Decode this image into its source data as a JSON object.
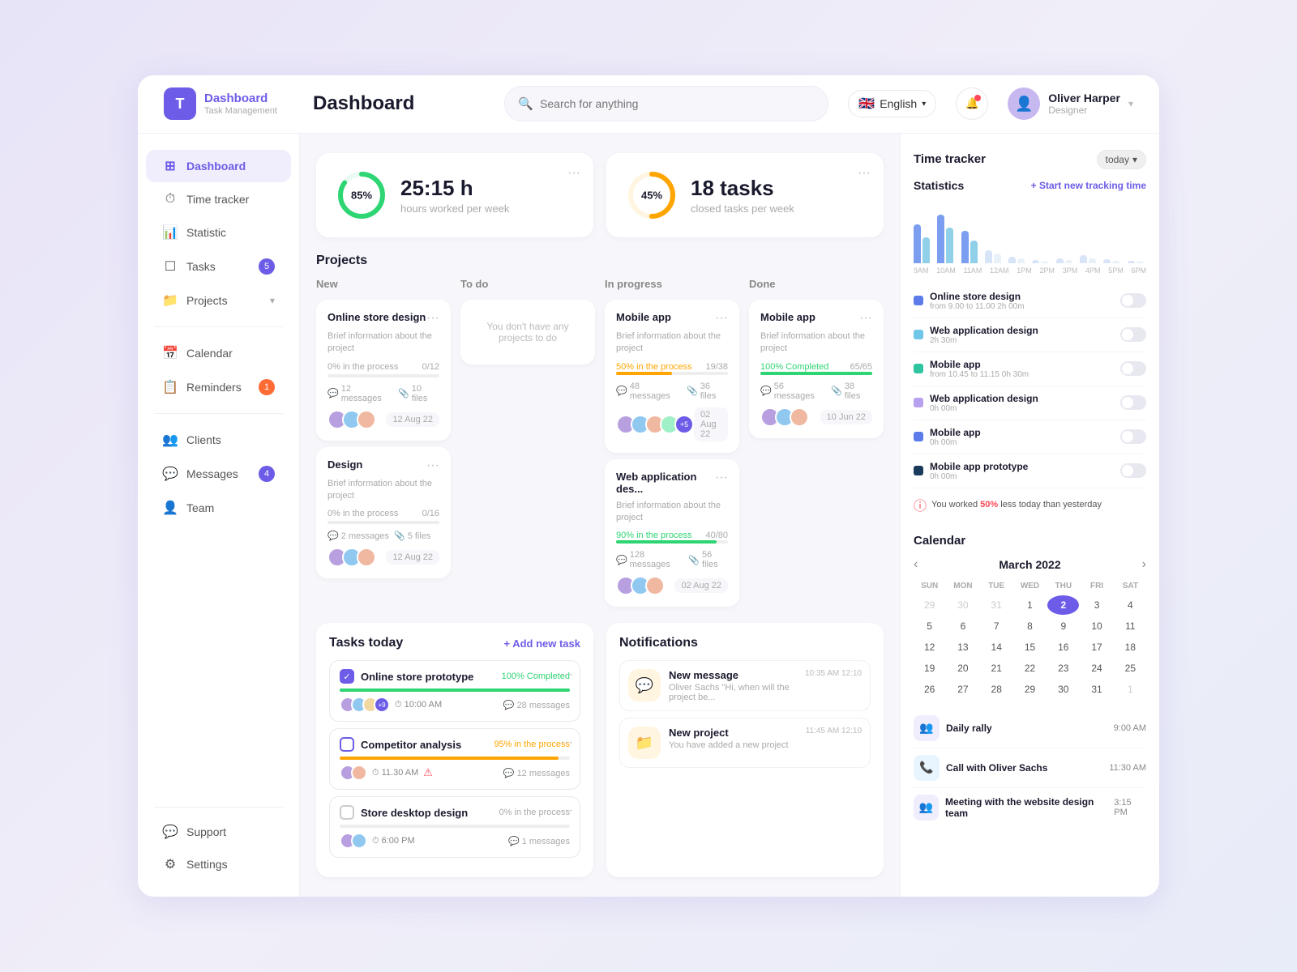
{
  "app": {
    "logo_letter": "T",
    "logo_title": "Dashboard",
    "logo_sub": "Task Management",
    "page_title": "Dashboard"
  },
  "header": {
    "search_placeholder": "Search for anything",
    "language": "English",
    "user_name": "Oliver Harper",
    "user_role": "Designer"
  },
  "sidebar": {
    "items": [
      {
        "id": "dashboard",
        "label": "Dashboard",
        "icon": "⊞",
        "active": true
      },
      {
        "id": "time-tracker",
        "label": "Time tracker",
        "icon": "○"
      },
      {
        "id": "statistic",
        "label": "Statistic",
        "icon": "📊"
      },
      {
        "id": "tasks",
        "label": "Tasks",
        "icon": "☐",
        "badge": "5"
      },
      {
        "id": "projects",
        "label": "Projects",
        "icon": "📁",
        "chevron": true
      }
    ],
    "items2": [
      {
        "id": "calendar",
        "label": "Calendar",
        "icon": "📅"
      },
      {
        "id": "reminders",
        "label": "Reminders",
        "icon": "📋",
        "badge": "1",
        "badge_color": "orange"
      }
    ],
    "items3": [
      {
        "id": "clients",
        "label": "Clients",
        "icon": "👥"
      },
      {
        "id": "messages",
        "label": "Messages",
        "icon": "💬",
        "badge": "4"
      },
      {
        "id": "team",
        "label": "Team",
        "icon": "👤"
      }
    ],
    "bottom": [
      {
        "id": "support",
        "label": "Support",
        "icon": "💬"
      },
      {
        "id": "settings",
        "label": "Settings",
        "icon": "⚙"
      }
    ]
  },
  "stats": [
    {
      "pct": 85,
      "value": "25:15 h",
      "label": "hours worked per week",
      "color_stroke": "#2ed573",
      "color_track": "#e8faf2"
    },
    {
      "pct": 45,
      "value": "18 tasks",
      "label": "closed tasks per week",
      "color_stroke": "#ffa502",
      "color_track": "#fff5e0"
    }
  ],
  "projects": {
    "section_title": "Projects",
    "columns": [
      {
        "id": "new",
        "label": "New"
      },
      {
        "id": "todo",
        "label": "To do"
      },
      {
        "id": "inprogress",
        "label": "In progress"
      },
      {
        "id": "done",
        "label": "Done"
      }
    ],
    "cards": {
      "new": [
        {
          "title": "Online store design",
          "desc": "Brief information about the project",
          "progress_label": "0% in the process",
          "progress_pct": 0,
          "progress_count": "0/12",
          "progress_color": "gray",
          "messages": "12 messages",
          "files": "10 files",
          "date": "12 Aug 22",
          "avatars": [
            "#b8a0e0",
            "#90c8f0",
            "#f0b8a0"
          ]
        },
        {
          "title": "Design",
          "desc": "Brief information about the project",
          "progress_label": "0% in the process",
          "progress_pct": 0,
          "progress_count": "0/16",
          "progress_color": "gray",
          "messages": "2 messages",
          "files": "5 files",
          "date": "12 Aug 22",
          "avatars": [
            "#b8a0e0",
            "#90c8f0",
            "#f0b8a0"
          ]
        }
      ],
      "todo": [],
      "inprogress": [
        {
          "title": "Mobile app",
          "desc": "Brief information about the project",
          "progress_label": "50% in the process",
          "progress_pct": 50,
          "progress_count": "19/38",
          "progress_color": "orange",
          "messages": "48 messages",
          "files": "36 files",
          "date": "02 Aug 22",
          "avatars": [
            "#b8a0e0",
            "#90c8f0",
            "#f0b8a0",
            "#a0f0c8",
            "#f0d8a0"
          ]
        },
        {
          "title": "Web application des...",
          "desc": "Brief information about the project",
          "progress_label": "90% in the process",
          "progress_pct": 90,
          "progress_count": "40/80",
          "progress_color": "green",
          "messages": "128 messages",
          "files": "56 files",
          "date": "02 Aug 22",
          "avatars": [
            "#b8a0e0",
            "#90c8f0",
            "#f0b8a0"
          ]
        }
      ],
      "done": [
        {
          "title": "Mobile app",
          "desc": "Brief information about the project",
          "progress_label": "100% Completed",
          "progress_pct": 100,
          "progress_count": "65/65",
          "progress_color": "green",
          "messages": "56 messages",
          "files": "38 files",
          "date": "10 Jun 22",
          "avatars": [
            "#b8a0e0",
            "#90c8f0",
            "#f0b8a0"
          ]
        }
      ]
    },
    "todo_empty": "You don't have any projects to do"
  },
  "tasks_today": {
    "section_title": "Tasks today",
    "add_label": "+ Add new task",
    "tasks": [
      {
        "name": "Online store prototype",
        "done": true,
        "progress_label": "100% Completed",
        "progress_pct": 100,
        "progress_color": "green",
        "time": "10:00 AM",
        "messages": "28 messages",
        "avatars": [
          "#b8a0e0",
          "#90c8f0",
          "#f0d8a0",
          "#a0f0c8"
        ]
      },
      {
        "name": "Competitor analysis",
        "done": false,
        "progress_label": "95% in the process",
        "progress_pct": 95,
        "progress_color": "orange",
        "time": "11.30 AM",
        "warn": true,
        "messages": "12 messages",
        "avatars": [
          "#b8a0e0",
          "#f0b8a0"
        ]
      },
      {
        "name": "Store desktop design",
        "done": false,
        "progress_label": "0% in the process",
        "progress_pct": 0,
        "progress_color": "gray",
        "time": "6:00 PM",
        "messages": "1 messages",
        "avatars": [
          "#b8a0e0",
          "#90c8f0"
        ]
      }
    ]
  },
  "notifications": {
    "section_title": "Notifications",
    "items": [
      {
        "title": "New message",
        "desc": "Oliver Sachs \"Hi, when will the project be...",
        "time": "10:35 AM 12:10"
      },
      {
        "title": "New project",
        "desc": "You have added a new project",
        "time": "11:45 AM 12:10"
      }
    ]
  },
  "time_tracker": {
    "section_title": "Time tracker",
    "today_label": "today",
    "stats_title": "Statistics",
    "start_btn": "+ Start new tracking time",
    "chart_labels": [
      "9AM",
      "10AM",
      "11AM",
      "12AM",
      "1PM",
      "2PM",
      "3PM",
      "4PM",
      "5PM",
      "6PM"
    ],
    "chart_bars": [
      [
        60,
        40
      ],
      [
        75,
        55
      ],
      [
        50,
        35
      ],
      [
        20,
        15
      ],
      [
        10,
        8
      ],
      [
        5,
        3
      ],
      [
        8,
        5
      ],
      [
        12,
        8
      ],
      [
        6,
        4
      ],
      [
        4,
        2
      ]
    ],
    "bar_colors": [
      "#7b9ef0",
      "#90d0e8"
    ],
    "items": [
      {
        "name": "Online store design",
        "sub": "from 9.00 to 11.00 2h 00m",
        "color": "#5b7be8",
        "on": false
      },
      {
        "name": "Web application design",
        "sub": "2h 30m",
        "color": "#6ec6e8",
        "on": false
      },
      {
        "name": "Mobile app",
        "sub": "from 10.45 to 11.15 0h 30m",
        "color": "#2ec4a0",
        "on": false
      },
      {
        "name": "Web application design",
        "sub": "0h 00m",
        "color": "#b8a0f0",
        "on": false
      },
      {
        "name": "Mobile app",
        "sub": "0h 00m",
        "color": "#5b7be8",
        "on": false
      },
      {
        "name": "Mobile app prototype",
        "sub": "0h 00m",
        "color": "#1a3a5c",
        "on": false
      }
    ],
    "alert": "You worked 50% less today than yesterday",
    "alert_pct": "50%"
  },
  "calendar": {
    "section_title": "Calendar",
    "month": "March 2022",
    "day_headers": [
      "SUN",
      "MON",
      "TUE",
      "WED",
      "THU",
      "FRI",
      "SAT"
    ],
    "days": [
      {
        "d": "29",
        "other": true
      },
      {
        "d": "30",
        "other": true
      },
      {
        "d": "31",
        "other": true
      },
      {
        "d": "1"
      },
      {
        "d": "2",
        "today": true
      },
      {
        "d": "3"
      },
      {
        "d": "4"
      },
      {
        "d": "5"
      },
      {
        "d": "6"
      },
      {
        "d": "7"
      },
      {
        "d": "8"
      },
      {
        "d": "9"
      },
      {
        "d": "10"
      },
      {
        "d": "11"
      },
      {
        "d": "12"
      },
      {
        "d": "13"
      },
      {
        "d": "14"
      },
      {
        "d": "15"
      },
      {
        "d": "16"
      },
      {
        "d": "17"
      },
      {
        "d": "18"
      },
      {
        "d": "19"
      },
      {
        "d": "20"
      },
      {
        "d": "21"
      },
      {
        "d": "22"
      },
      {
        "d": "23"
      },
      {
        "d": "24"
      },
      {
        "d": "25"
      },
      {
        "d": "26"
      },
      {
        "d": "27"
      },
      {
        "d": "28"
      },
      {
        "d": "29"
      },
      {
        "d": "30"
      },
      {
        "d": "31"
      },
      {
        "d": "1",
        "other": true
      }
    ],
    "events": [
      {
        "name": "Daily rally",
        "icon": "👥",
        "time": "9:00 AM"
      },
      {
        "name": "Call with Oliver Sachs",
        "icon": "📞",
        "time": "11:30 AM"
      },
      {
        "name": "Meeting with the website design team",
        "icon": "👥",
        "time": "3:15 PM"
      }
    ]
  }
}
